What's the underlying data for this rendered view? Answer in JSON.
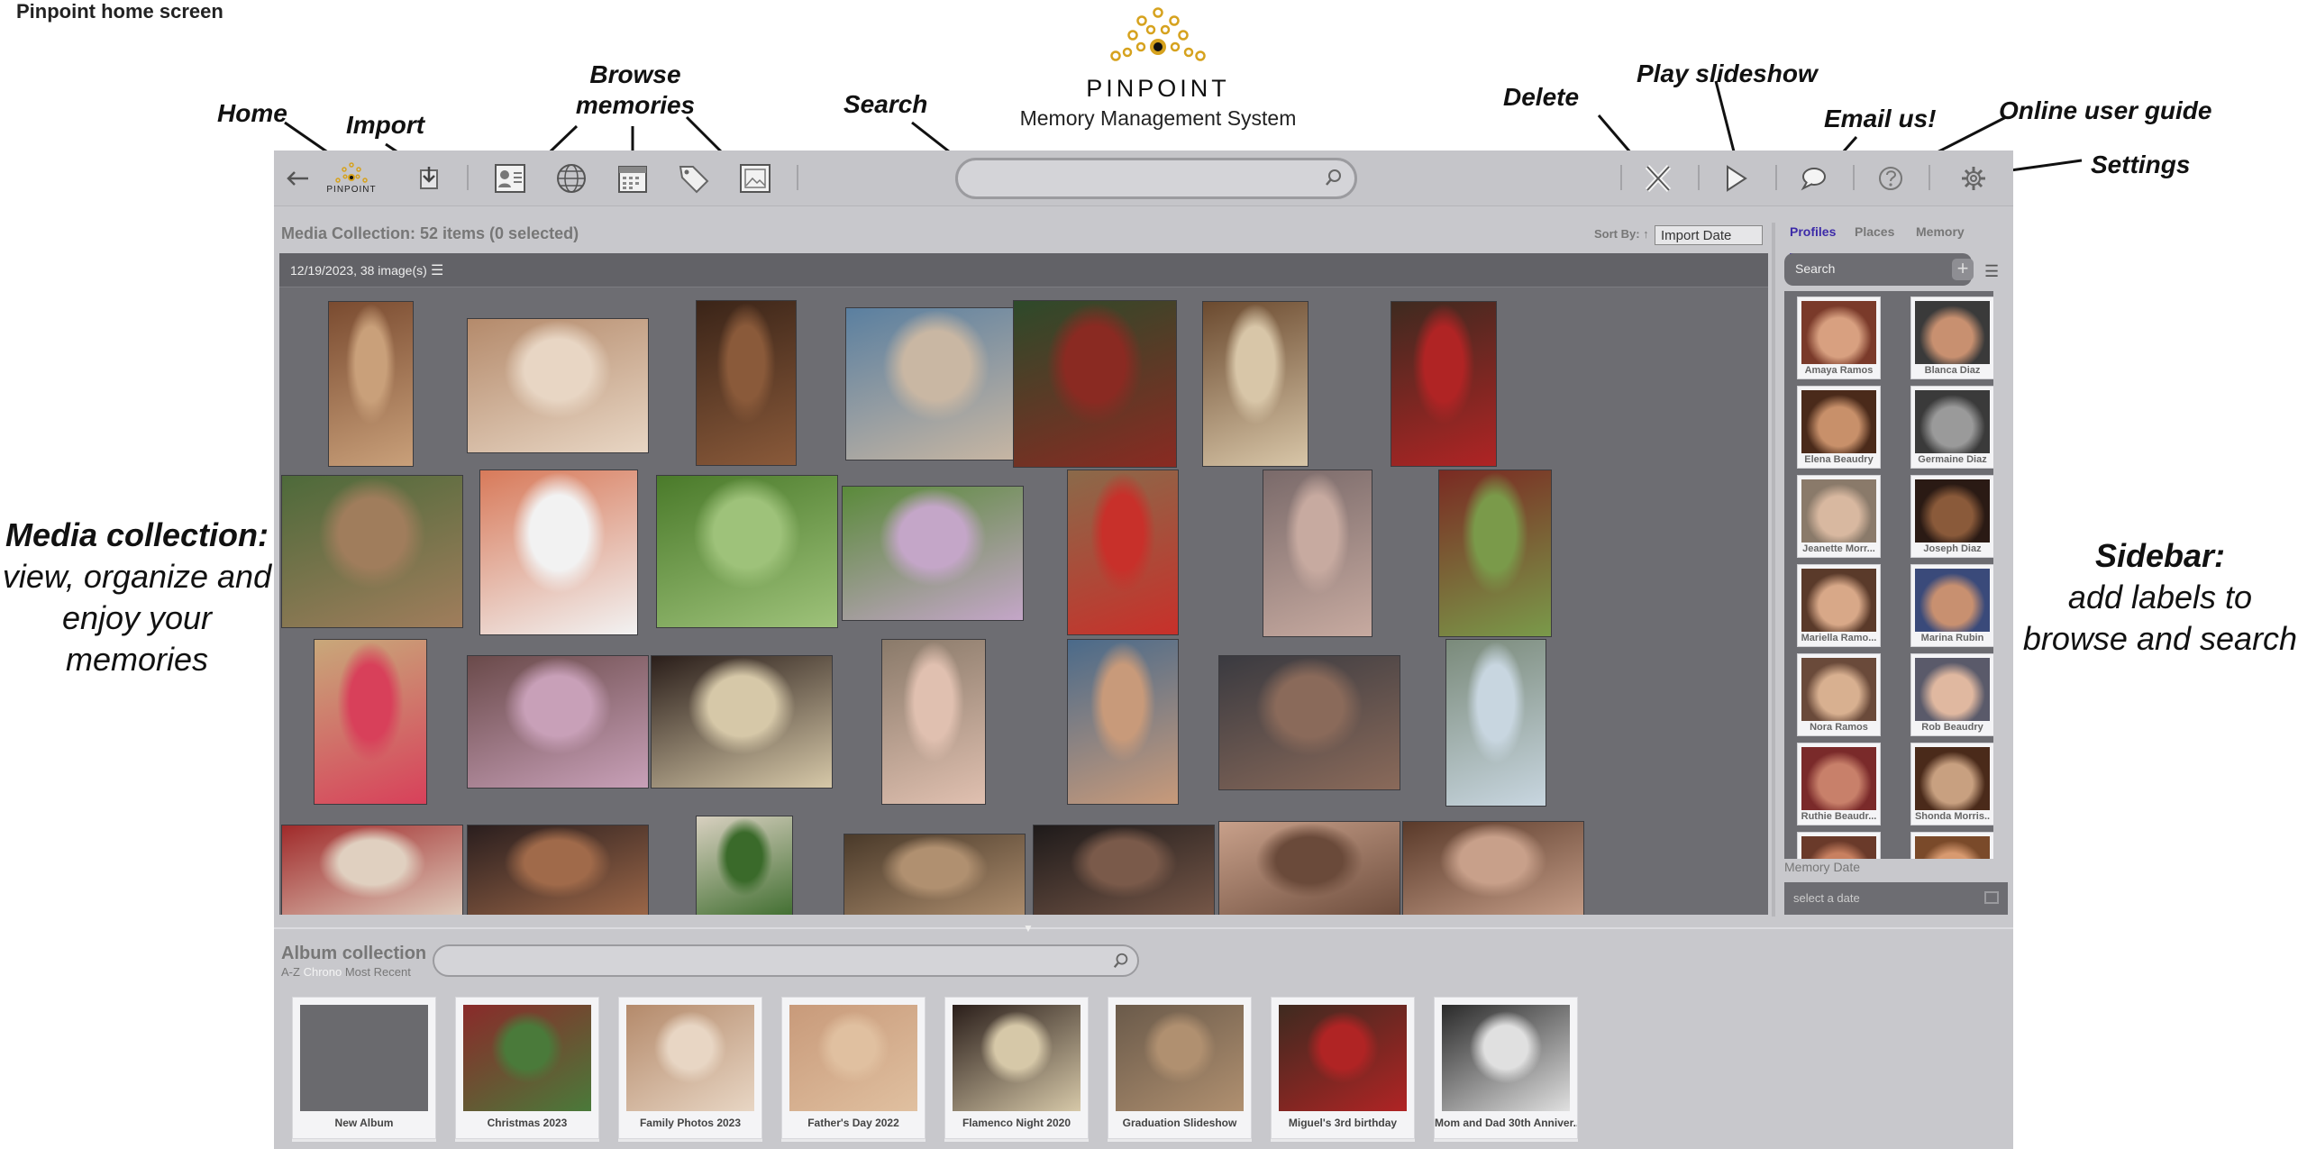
{
  "page_caption": "Pinpoint home screen",
  "logo": {
    "word": "PINPOINT",
    "subtitle": "Memory Management System",
    "mini_word": "PINPOINT",
    "gold": "#d6a21e"
  },
  "callouts": {
    "home": "Home",
    "import": "Import",
    "browse": "Browse memories",
    "search": "Search",
    "delete": "Delete",
    "play": "Play slideshow",
    "email": "Email us!",
    "guide": "Online user guide",
    "settings": "Settings"
  },
  "side_notes": {
    "media_title": "Media collection:",
    "media_lines": [
      "view, organize and",
      "enjoy your",
      "memories"
    ],
    "sidebar_title": "Sidebar:",
    "sidebar_lines": [
      "add labels to",
      "browse and search"
    ]
  },
  "toolbar": {
    "icons": [
      "back-arrow-icon",
      "pinpoint-logo-icon",
      "import-icon",
      "profile-card-icon",
      "globe-icon",
      "calendar-icon",
      "tag-icon",
      "image-frame-icon",
      "delete-x-icon",
      "play-icon",
      "chat-bubble-icon",
      "help-icon",
      "gear-icon"
    ],
    "search_placeholder": ""
  },
  "media": {
    "title": "Media Collection: 52 items (0 selected)",
    "sort_by_label": "Sort By: ↑",
    "sort_value": "Import Date",
    "date_group": "12/19/2023, 38 image(s)",
    "photo_colors": [
      [
        "#7a4b30",
        "#c9a07a"
      ],
      [
        "#b48a6b",
        "#e8d6c4"
      ],
      [
        "#3a2418",
        "#8a5a3a"
      ],
      [
        "#5a7fa0",
        "#c9b7a3"
      ],
      [
        "#2d4a2a",
        "#8a2a22"
      ],
      [
        "#6b4a2f",
        "#d8c6a8"
      ],
      [
        "#3e2a20",
        "#b02424"
      ],
      [
        "#4d6a3a",
        "#a07d5c"
      ],
      [
        "#d87a5a",
        "#f2f2f2"
      ],
      [
        "#4a7a2a",
        "#9ec27a"
      ],
      [
        "#5a8a3a",
        "#c4a6c8"
      ],
      [
        "#8a6a4a",
        "#c8302a"
      ],
      [
        "#7a6a6a",
        "#c7aaa0"
      ],
      [
        "#7a2a22",
        "#7a9a4a"
      ],
      [
        "#c8a87a",
        "#d8405a"
      ],
      [
        "#6a4a4a",
        "#c8a0b8"
      ],
      [
        "#2a1e1a",
        "#d6c8a8"
      ],
      [
        "#8a7a6a",
        "#e0c0b0"
      ],
      [
        "#4a6a8a",
        "#c89a7a"
      ],
      [
        "#3a3a40",
        "#8a6a5a"
      ],
      [
        "#7a8a7a",
        "#c8d6e0"
      ],
      [
        "#a02a2a",
        "#e0d0c0"
      ],
      [
        "#2a1e1e",
        "#a06a4a"
      ],
      [
        "#d8d0c0",
        "#3a6a2a"
      ],
      [
        "#4a3a2a",
        "#b09070"
      ],
      [
        "#1e1a1a",
        "#7a5a4a"
      ],
      [
        "#c8a08a",
        "#6a4a3a"
      ],
      [
        "#5a3a2a",
        "#c8a08a"
      ]
    ]
  },
  "album": {
    "title": "Album collection",
    "sort_options": [
      "A-Z",
      "Chrono",
      "Most Recent"
    ],
    "search_placeholder": "",
    "cards": [
      {
        "name": "New Album",
        "colors": [
          "#6a6a6e",
          "#6a6a6e"
        ]
      },
      {
        "name": "Christmas 2023",
        "colors": [
          "#8a2a2a",
          "#4a7a3a"
        ]
      },
      {
        "name": "Family Photos 2023",
        "colors": [
          "#b48a6b",
          "#e8d6c4"
        ]
      },
      {
        "name": "Father's Day 2022",
        "colors": [
          "#c89a7a",
          "#e0c0a0"
        ]
      },
      {
        "name": "Flamenco Night 2020",
        "colors": [
          "#2a1e1a",
          "#d6c8a8"
        ]
      },
      {
        "name": "Graduation Slideshow",
        "colors": [
          "#6a5a4a",
          "#b09070"
        ]
      },
      {
        "name": "Miguel's 3rd birthday",
        "colors": [
          "#3e2a20",
          "#b02424"
        ]
      },
      {
        "name": "Mom and Dad 30th Anniver...",
        "colors": [
          "#2a2a2a",
          "#e0e0e0"
        ]
      }
    ]
  },
  "sidebar": {
    "tabs": [
      "Profiles",
      "Places",
      "Memory"
    ],
    "search_label": "Search",
    "add_label": "+",
    "profiles": [
      {
        "name": "Amaya Ramos",
        "colors": [
          "#7a3a2a",
          "#d8a080"
        ]
      },
      {
        "name": "Blanca Diaz",
        "colors": [
          "#3a3a3a",
          "#c89070"
        ]
      },
      {
        "name": "Elena Beaudry",
        "colors": [
          "#4a2a1a",
          "#c8906a"
        ]
      },
      {
        "name": "Germaine Diaz",
        "colors": [
          "#3a3a3a",
          "#9a9a9a"
        ]
      },
      {
        "name": "Jeanette Morr...",
        "colors": [
          "#8a7a6a",
          "#d8b8a0"
        ]
      },
      {
        "name": "Joseph Diaz",
        "colors": [
          "#2a1a14",
          "#8a5a3a"
        ]
      },
      {
        "name": "Mariella Ramo...",
        "colors": [
          "#5a3a2a",
          "#d8a888"
        ]
      },
      {
        "name": "Marina Rubin",
        "colors": [
          "#3a4a7a",
          "#c89070"
        ]
      },
      {
        "name": "Nora Ramos",
        "colors": [
          "#6a4a3a",
          "#d8b090"
        ]
      },
      {
        "name": "Rob Beaudry",
        "colors": [
          "#5a5a6a",
          "#e0b8a0"
        ]
      },
      {
        "name": "Ruthie Beaudr...",
        "colors": [
          "#7a2a2a",
          "#c8806a"
        ]
      },
      {
        "name": "Shonda Morris..",
        "colors": [
          "#4a2a1a",
          "#c8a080"
        ]
      },
      {
        "name": "",
        "colors": [
          "#6a3a2a",
          "#c88060"
        ]
      },
      {
        "name": "",
        "colors": [
          "#7a4a2a",
          "#d89a70"
        ]
      }
    ],
    "memory_date_label": "Memory Date",
    "date_placeholder": "select a date"
  }
}
